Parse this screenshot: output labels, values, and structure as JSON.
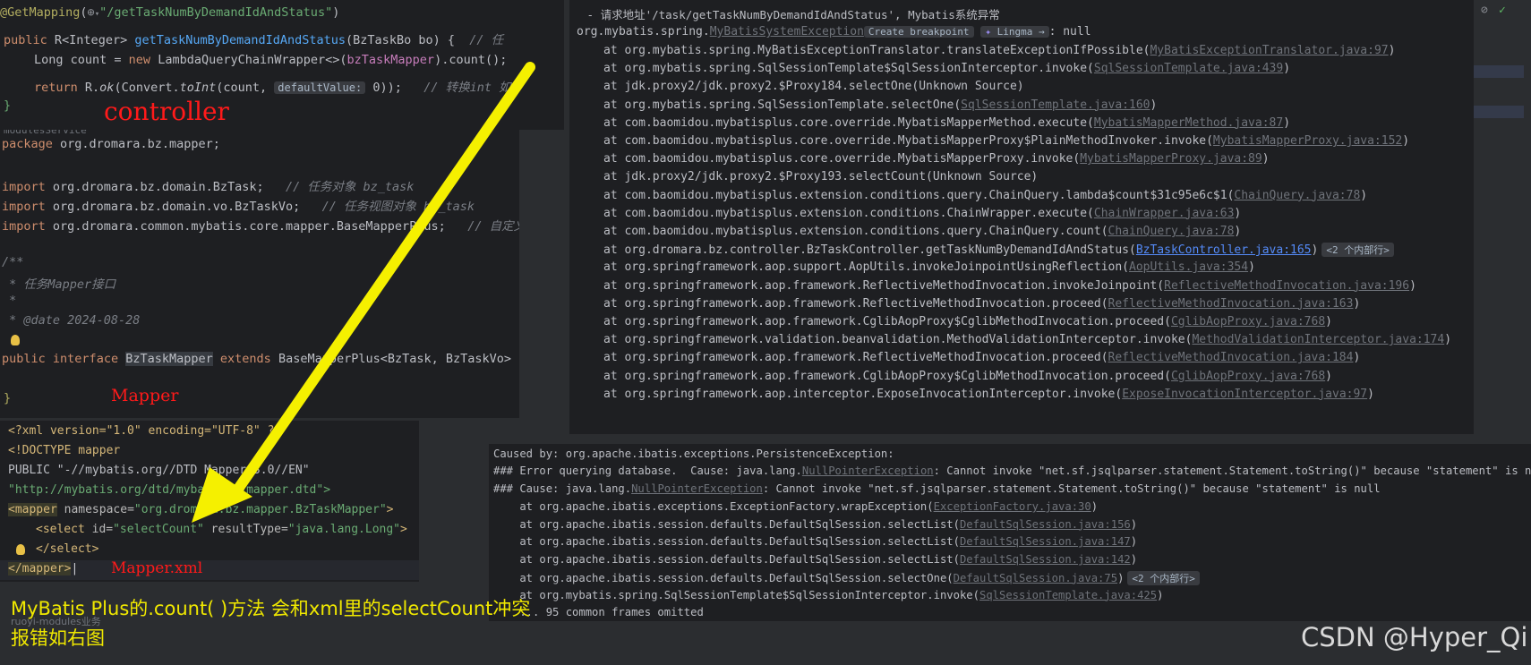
{
  "controller": {
    "mapping": "@GetMapping",
    "path": "\"/getTaskNumByDemandIdAndStatus\"",
    "sig_public": "public",
    "sig_type": "R<Integer>",
    "method": "getTaskNumByDemandIdAndStatus",
    "params": "(BzTaskBo bo) {",
    "comment1": "// 任",
    "line2_a": "Long count = ",
    "line2_new": "new",
    "line2_b": " LambdaQueryChainWrapper<>(",
    "line2_mapper": "bzTaskMapper",
    "line2_c": ").count();",
    "line3_ret": "return",
    "line3_a": " R.",
    "line3_ok": "ok",
    "line3_b": "(Convert.",
    "line3_toint": "toInt",
    "line3_c": "(count, ",
    "line3_hint": "defaultValue:",
    "line3_d": " 0));",
    "line3_cm": "// 转换int 如",
    "close": "}",
    "label": "controller"
  },
  "mapper_java": {
    "pkg_kw": "package",
    "pkg": " org.dromara.bz.mapper;",
    "imp1": " org.dromara.bz.domain.BzTask;",
    "imp1_cm": "// 任务对象 bz_task",
    "imp2": " org.dromara.bz.domain.vo.BzTaskVo;",
    "imp2_cm": "// 任务视图对象 bz_task",
    "imp3": " org.dromara.common.mybatis.core.mapper.BaseMapperPlus;",
    "imp3_cm": "// 自定义",
    "import_kw": "import",
    "doc1": "/**",
    "doc2": " * 任务Mapper接口",
    "doc3": " *",
    "doc4": " * @date 2024-08-28",
    "decl_public": "public",
    "decl_interface": "interface",
    "decl_name": "BzTaskMapper",
    "decl_extends": "extends",
    "decl_rest": " BaseMapperPlus<BzTask, BzTaskVo> {",
    "close": "}",
    "label": "Mapper",
    "top_fragment": "modulesService"
  },
  "mapper_xml": {
    "l1": "<?xml version=\"1.0\" encoding=\"UTF-8\" ?>",
    "l2": "<!DOCTYPE mapper",
    "l3": "PUBLIC \"-//mybatis.org//DTD Mapper 3.0//EN\"",
    "l4": "\"http://mybatis.org/dtd/mybatis-3-mapper.dtd\">",
    "l5_tag": "<mapper",
    "l5_attr": " namespace=",
    "l5_val": "\"org.dromara.bz.mapper.BzTaskMapper\"",
    "l5_end": ">",
    "l6_tag": "<select",
    "l6_attr1": " id=",
    "l6_val1": "\"selectCount\"",
    "l6_attr2": " resultType=",
    "l6_val2": "\"java.lang.Long\"",
    "l6_end": ">",
    "l7": "</select>",
    "l8": "</mapper>",
    "label": "Mapper.xml"
  },
  "run_console": {
    "header": " - 请求地址'/task/getTaskNumByDemandIdAndStatus', Mybatis系统异常",
    "ex_prefix": "org.mybatis.spring.",
    "ex_link": "MyBatisSystemException",
    "ex_create_bp": "Create breakpoint",
    "ex_lingma": "Lingma",
    "ex_suffix": ": null",
    "frames": [
      {
        "text": "at org.mybatis.spring.MyBatisExceptionTranslator.translateExceptionIfPossible(",
        "link": "MyBatisExceptionTranslator.java:97",
        "end": ")"
      },
      {
        "text": "at org.mybatis.spring.SqlSessionTemplate$SqlSessionInterceptor.invoke(",
        "link": "SqlSessionTemplate.java:439",
        "end": ")"
      },
      {
        "text": "at jdk.proxy2/jdk.proxy2.$Proxy184.selectOne(Unknown Source)",
        "link": "",
        "end": ""
      },
      {
        "text": "at org.mybatis.spring.SqlSessionTemplate.selectOne(",
        "link": "SqlSessionTemplate.java:160",
        "end": ")"
      },
      {
        "text": "at com.baomidou.mybatisplus.core.override.MybatisMapperMethod.execute(",
        "link": "MybatisMapperMethod.java:87",
        "end": ")"
      },
      {
        "text": "at com.baomidou.mybatisplus.core.override.MybatisMapperProxy$PlainMethodInvoker.invoke(",
        "link": "MybatisMapperProxy.java:152",
        "end": ")"
      },
      {
        "text": "at com.baomidou.mybatisplus.core.override.MybatisMapperProxy.invoke(",
        "link": "MybatisMapperProxy.java:89",
        "end": ")"
      },
      {
        "text": "at jdk.proxy2/jdk.proxy2.$Proxy193.selectCount(Unknown Source)",
        "link": "",
        "end": ""
      },
      {
        "text": "at com.baomidou.mybatisplus.extension.conditions.query.ChainQuery.lambda$count$31c95e6c$1(",
        "link": "ChainQuery.java:78",
        "end": ")"
      },
      {
        "text": "at com.baomidou.mybatisplus.extension.conditions.ChainWrapper.execute(",
        "link": "ChainWrapper.java:63",
        "end": ")"
      },
      {
        "text": "at com.baomidou.mybatisplus.extension.conditions.query.ChainQuery.count(",
        "link": "ChainQuery.java:78",
        "end": ")"
      },
      {
        "text": "at org.dromara.bz.controller.BzTaskController.getTaskNumByDemandIdAndStatus(",
        "link": "BzTaskController.java:165",
        "end": ")",
        "badge": "<2 个内部行>",
        "highlight": true
      },
      {
        "text": "at org.springframework.aop.support.AopUtils.invokeJoinpointUsingReflection(",
        "link": "AopUtils.java:354",
        "end": ")"
      },
      {
        "text": "at org.springframework.aop.framework.ReflectiveMethodInvocation.invokeJoinpoint(",
        "link": "ReflectiveMethodInvocation.java:196",
        "end": ")"
      },
      {
        "text": "at org.springframework.aop.framework.ReflectiveMethodInvocation.proceed(",
        "link": "ReflectiveMethodInvocation.java:163",
        "end": ")"
      },
      {
        "text": "at org.springframework.aop.framework.CglibAopProxy$CglibMethodInvocation.proceed(",
        "link": "CglibAopProxy.java:768",
        "end": ")"
      },
      {
        "text": "at org.springframework.validation.beanvalidation.MethodValidationInterceptor.invoke(",
        "link": "MethodValidationInterceptor.java:174",
        "end": ")"
      },
      {
        "text": "at org.springframework.aop.framework.ReflectiveMethodInvocation.proceed(",
        "link": "ReflectiveMethodInvocation.java:184",
        "end": ")"
      },
      {
        "text": "at org.springframework.aop.framework.CglibAopProxy$CglibMethodInvocation.proceed(",
        "link": "CglibAopProxy.java:768",
        "end": ")"
      },
      {
        "text": "at org.springframework.aop.interceptor.ExposeInvocationInterceptor.invoke(",
        "link": "ExposeInvocationInterceptor.java:97",
        "end": ")"
      }
    ]
  },
  "caused_console": {
    "l1": "Caused by: org.apache.ibatis.exceptions.PersistenceException:",
    "l2_a": "### Error querying database.  Cause: java.lang.",
    "l2_link": "NullPointerException",
    "l2_b": ": Cannot invoke \"net.sf.jsqlparser.statement.Statement.toString()\" because \"statement\" is null",
    "l3_a": "### Cause: java.lang.",
    "l3_link": "NullPointerException",
    "l3_b": ": Cannot invoke \"net.sf.jsqlparser.statement.Statement.toString()\" because \"statement\" is null",
    "frames": [
      {
        "text": "    at org.apache.ibatis.exceptions.ExceptionFactory.wrapException(",
        "link": "ExceptionFactory.java:30",
        "end": ")"
      },
      {
        "text": "    at org.apache.ibatis.session.defaults.DefaultSqlSession.selectList(",
        "link": "DefaultSqlSession.java:156",
        "end": ")"
      },
      {
        "text": "    at org.apache.ibatis.session.defaults.DefaultSqlSession.selectList(",
        "link": "DefaultSqlSession.java:147",
        "end": ")"
      },
      {
        "text": "    at org.apache.ibatis.session.defaults.DefaultSqlSession.selectList(",
        "link": "DefaultSqlSession.java:142",
        "end": ")"
      },
      {
        "text": "    at org.apache.ibatis.session.defaults.DefaultSqlSession.selectOne(",
        "link": "DefaultSqlSession.java:75",
        "end": ")",
        "badge": "<2 个内部行>"
      },
      {
        "text": "    at org.mybatis.spring.SqlSessionTemplate$SqlSessionInterceptor.invoke(",
        "link": "SqlSessionTemplate.java:425",
        "end": ")"
      },
      {
        "text": "    ... 95 common frames omitted",
        "link": "",
        "end": ""
      }
    ]
  },
  "annotation": {
    "line1": "MyBatis Plus的.count( )方法 会和xml里的selectCount冲突",
    "line2": "报错如右图",
    "behind_fragment1": "ruoyi-modules业务",
    "watermark": "CSDN @Hyper_Qi"
  },
  "colors": {
    "arrow": "#f5f000",
    "label_red": "#ff1a1a",
    "annotation_yellow": "#f0e800"
  }
}
